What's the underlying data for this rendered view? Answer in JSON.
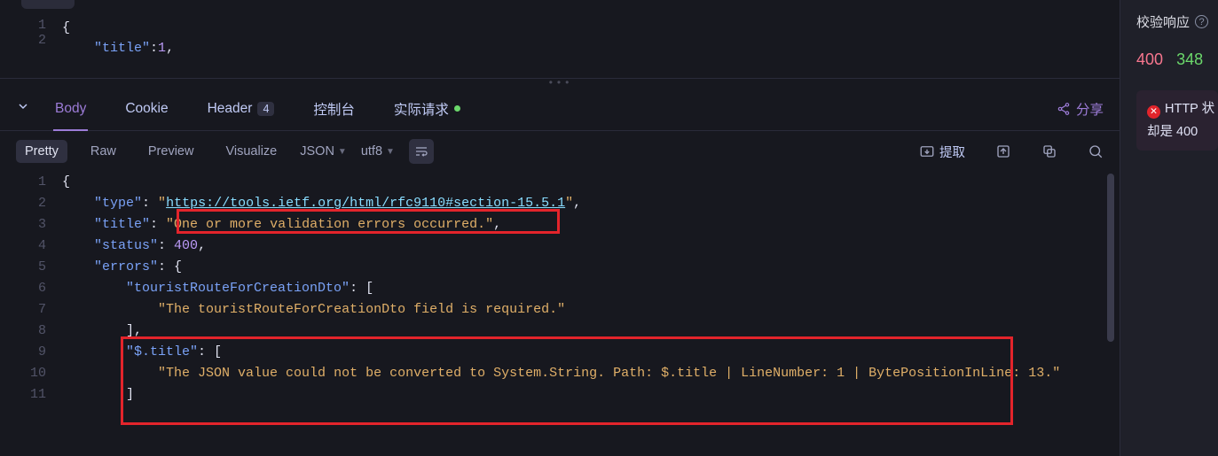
{
  "request_body": {
    "lines": [
      {
        "n": 1,
        "indent": 0,
        "tokens": [
          {
            "t": "{",
            "c": "pn"
          }
        ]
      },
      {
        "n": 2,
        "indent": 1,
        "tokens": [
          {
            "t": "\"title\"",
            "c": "key"
          },
          {
            "t": ":",
            "c": "pn"
          },
          {
            "t": "1",
            "c": "num"
          },
          {
            "t": ",",
            "c": "pn"
          }
        ]
      }
    ]
  },
  "tabs": {
    "body": "Body",
    "cookie": "Cookie",
    "header": "Header",
    "header_count": "4",
    "console": "控制台",
    "actual_request": "实际请求",
    "share": "分享"
  },
  "format_bar": {
    "pretty": "Pretty",
    "raw": "Raw",
    "preview": "Preview",
    "visualize": "Visualize",
    "lang": "JSON",
    "enc": "utf8",
    "extract": "提取"
  },
  "response": {
    "lines": [
      {
        "n": 1,
        "indent": 0,
        "tokens": [
          {
            "t": "{",
            "c": "pn"
          }
        ]
      },
      {
        "n": 2,
        "indent": 1,
        "tokens": [
          {
            "t": "\"type\"",
            "c": "key"
          },
          {
            "t": ": ",
            "c": "pn"
          },
          {
            "t": "\"",
            "c": "str"
          },
          {
            "t": "https://tools.ietf.org/html/rfc9110#section-15.5.1",
            "c": "link"
          },
          {
            "t": "\"",
            "c": "str"
          },
          {
            "t": ",",
            "c": "pn"
          }
        ]
      },
      {
        "n": 3,
        "indent": 1,
        "tokens": [
          {
            "t": "\"title\"",
            "c": "key"
          },
          {
            "t": ": ",
            "c": "pn"
          },
          {
            "t": "\"One or more validation errors occurred.\"",
            "c": "str"
          },
          {
            "t": ",",
            "c": "pn"
          }
        ]
      },
      {
        "n": 4,
        "indent": 1,
        "tokens": [
          {
            "t": "\"status\"",
            "c": "key"
          },
          {
            "t": ": ",
            "c": "pn"
          },
          {
            "t": "400",
            "c": "num"
          },
          {
            "t": ",",
            "c": "pn"
          }
        ]
      },
      {
        "n": 5,
        "indent": 1,
        "tokens": [
          {
            "t": "\"errors\"",
            "c": "key"
          },
          {
            "t": ": {",
            "c": "pn"
          }
        ]
      },
      {
        "n": 6,
        "indent": 2,
        "tokens": [
          {
            "t": "\"touristRouteForCreationDto\"",
            "c": "key"
          },
          {
            "t": ": [",
            "c": "pn"
          }
        ]
      },
      {
        "n": 7,
        "indent": 3,
        "tokens": [
          {
            "t": "\"The touristRouteForCreationDto field is required.\"",
            "c": "str"
          }
        ]
      },
      {
        "n": 8,
        "indent": 2,
        "tokens": [
          {
            "t": "],",
            "c": "pn"
          }
        ]
      },
      {
        "n": 9,
        "indent": 2,
        "tokens": [
          {
            "t": "\"$.title\"",
            "c": "key"
          },
          {
            "t": ": [",
            "c": "pn"
          }
        ]
      },
      {
        "n": 10,
        "indent": 3,
        "tokens": [
          {
            "t": "\"The JSON value could not be converted to System.String. Path: $.title | LineNumber: 1 | BytePositionInLine: 13.\"",
            "c": "str"
          }
        ]
      },
      {
        "n": 11,
        "indent": 2,
        "tokens": [
          {
            "t": "]",
            "c": "pn"
          }
        ]
      }
    ]
  },
  "right": {
    "title": "校验响应",
    "status_code": "400",
    "extra_code": "348",
    "err_line1": "HTTP 状",
    "err_line2": "却是 400"
  }
}
